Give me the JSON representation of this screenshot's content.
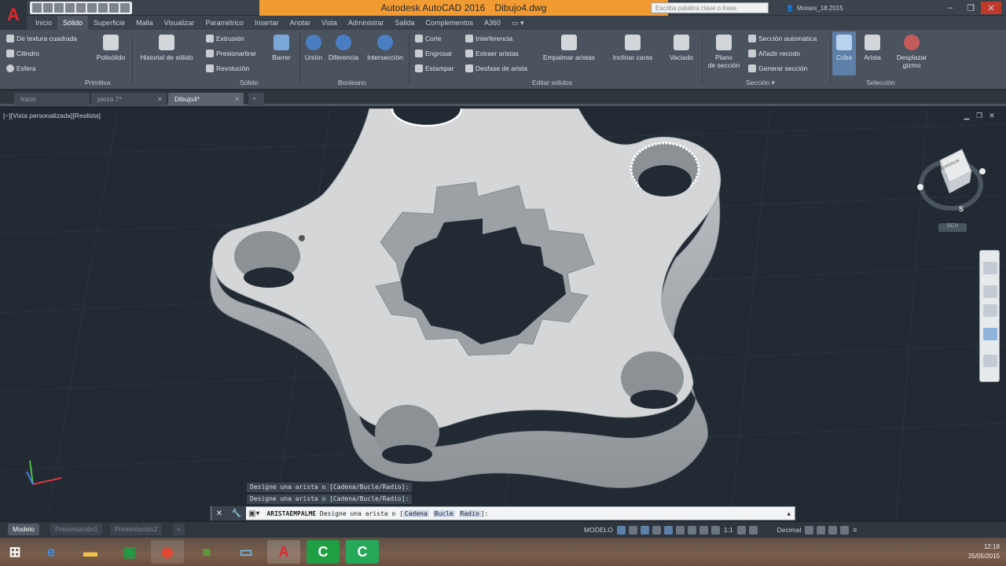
{
  "title": {
    "app": "Autodesk AutoCAD 2016",
    "file": "Dibujo4.dwg",
    "search_placeholder": "Escriba palabra clave o frase",
    "user": "Moises_18.2015"
  },
  "ribbon_tabs": [
    "Inicio",
    "Sólido",
    "Superficie",
    "Malla",
    "Visualizar",
    "Paramétrico",
    "Insertar",
    "Anotar",
    "Vista",
    "Administrar",
    "Salida",
    "Complementos",
    "A360"
  ],
  "active_ribbon_tab": "Sólido",
  "ribbon": {
    "primitiva": {
      "label": "Primitiva",
      "small_tools": [
        "De textura cuadrada",
        "Cilindro",
        "Esfera"
      ],
      "big_tools": [
        "Polisólido"
      ]
    },
    "solido": {
      "label": "Sólido",
      "big_tools": [
        "Historial de sólido"
      ],
      "small_tools": [
        "Extrusión",
        "Presionartirar",
        "Revolución"
      ],
      "barrer": "Barrer"
    },
    "booleano": {
      "label": "Booleano",
      "tools": [
        "Unión",
        "Diferencia",
        "Intersección"
      ]
    },
    "editar": {
      "label": "Editar sólidos",
      "small_col1": [
        "Corte",
        "Engrosar",
        "Estampar"
      ],
      "small_col2": [
        "Interferencia",
        "Extraer aristas",
        "Desfase de arista"
      ],
      "big_tools": [
        "Empalmar aristas",
        "Inclinar caras",
        "Vaciado"
      ]
    },
    "seccion": {
      "label": "Sección",
      "plano_line1": "Plano",
      "plano_line2": "de sección",
      "small_tools": [
        "Sección automática",
        "Añadir recodo",
        "Generar sección"
      ]
    },
    "seleccion": {
      "label": "Selección",
      "criba": "Criba",
      "arista": "Arista",
      "desplazar_line1": "Desplazar",
      "desplazar_line2": "gizmo"
    }
  },
  "doc_tabs": [
    "Inicio",
    "pieza 7*",
    "Dibujo4*"
  ],
  "active_doc_tab": "Dibujo4*",
  "viewport": {
    "label": "[−][Vista personalizada][Realista]",
    "viewcube_face": "SUPERIOR",
    "viewcube_compass": "S",
    "wcs_label": "SCU"
  },
  "command": {
    "history": [
      "Designe una arista o [Cadena/Bucle/Radio]:",
      "Designe una arista o [Cadena/Bucle/Radio]:"
    ],
    "current_cmd": "ARISTAEMPALME",
    "prompt": "Designe una arista o [",
    "options": [
      "Cadena",
      "Bucle",
      "Radio"
    ],
    "close": "]:"
  },
  "model_tabs": [
    "Modelo",
    "Presentación1",
    "Presentación2"
  ],
  "status": {
    "model": "MODELO",
    "scale": "1:1",
    "units": "Decimal"
  },
  "clock": {
    "time": "12:18",
    "date": "25/05/2015"
  },
  "colors": {
    "title_bg": "#f29b33",
    "accent": "#5d7fa8",
    "viewport_bg": "#222a33"
  }
}
